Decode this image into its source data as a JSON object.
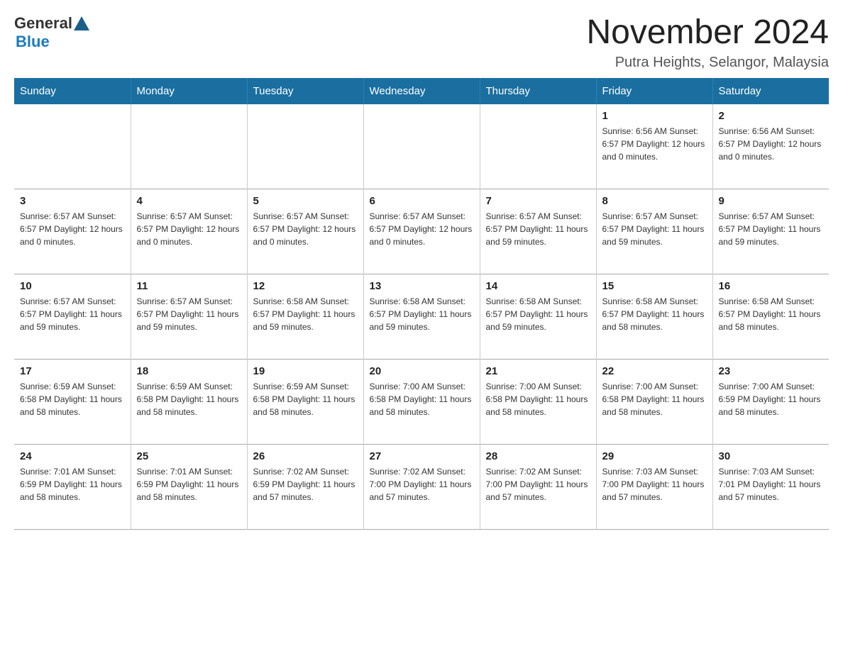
{
  "header": {
    "logo": {
      "general": "General",
      "blue": "Blue"
    },
    "title": "November 2024",
    "location": "Putra Heights, Selangor, Malaysia"
  },
  "columns": [
    "Sunday",
    "Monday",
    "Tuesday",
    "Wednesday",
    "Thursday",
    "Friday",
    "Saturday"
  ],
  "weeks": [
    [
      {
        "day": "",
        "info": ""
      },
      {
        "day": "",
        "info": ""
      },
      {
        "day": "",
        "info": ""
      },
      {
        "day": "",
        "info": ""
      },
      {
        "day": "",
        "info": ""
      },
      {
        "day": "1",
        "info": "Sunrise: 6:56 AM\nSunset: 6:57 PM\nDaylight: 12 hours\nand 0 minutes."
      },
      {
        "day": "2",
        "info": "Sunrise: 6:56 AM\nSunset: 6:57 PM\nDaylight: 12 hours\nand 0 minutes."
      }
    ],
    [
      {
        "day": "3",
        "info": "Sunrise: 6:57 AM\nSunset: 6:57 PM\nDaylight: 12 hours\nand 0 minutes."
      },
      {
        "day": "4",
        "info": "Sunrise: 6:57 AM\nSunset: 6:57 PM\nDaylight: 12 hours\nand 0 minutes."
      },
      {
        "day": "5",
        "info": "Sunrise: 6:57 AM\nSunset: 6:57 PM\nDaylight: 12 hours\nand 0 minutes."
      },
      {
        "day": "6",
        "info": "Sunrise: 6:57 AM\nSunset: 6:57 PM\nDaylight: 12 hours\nand 0 minutes."
      },
      {
        "day": "7",
        "info": "Sunrise: 6:57 AM\nSunset: 6:57 PM\nDaylight: 11 hours\nand 59 minutes."
      },
      {
        "day": "8",
        "info": "Sunrise: 6:57 AM\nSunset: 6:57 PM\nDaylight: 11 hours\nand 59 minutes."
      },
      {
        "day": "9",
        "info": "Sunrise: 6:57 AM\nSunset: 6:57 PM\nDaylight: 11 hours\nand 59 minutes."
      }
    ],
    [
      {
        "day": "10",
        "info": "Sunrise: 6:57 AM\nSunset: 6:57 PM\nDaylight: 11 hours\nand 59 minutes."
      },
      {
        "day": "11",
        "info": "Sunrise: 6:57 AM\nSunset: 6:57 PM\nDaylight: 11 hours\nand 59 minutes."
      },
      {
        "day": "12",
        "info": "Sunrise: 6:58 AM\nSunset: 6:57 PM\nDaylight: 11 hours\nand 59 minutes."
      },
      {
        "day": "13",
        "info": "Sunrise: 6:58 AM\nSunset: 6:57 PM\nDaylight: 11 hours\nand 59 minutes."
      },
      {
        "day": "14",
        "info": "Sunrise: 6:58 AM\nSunset: 6:57 PM\nDaylight: 11 hours\nand 59 minutes."
      },
      {
        "day": "15",
        "info": "Sunrise: 6:58 AM\nSunset: 6:57 PM\nDaylight: 11 hours\nand 58 minutes."
      },
      {
        "day": "16",
        "info": "Sunrise: 6:58 AM\nSunset: 6:57 PM\nDaylight: 11 hours\nand 58 minutes."
      }
    ],
    [
      {
        "day": "17",
        "info": "Sunrise: 6:59 AM\nSunset: 6:58 PM\nDaylight: 11 hours\nand 58 minutes."
      },
      {
        "day": "18",
        "info": "Sunrise: 6:59 AM\nSunset: 6:58 PM\nDaylight: 11 hours\nand 58 minutes."
      },
      {
        "day": "19",
        "info": "Sunrise: 6:59 AM\nSunset: 6:58 PM\nDaylight: 11 hours\nand 58 minutes."
      },
      {
        "day": "20",
        "info": "Sunrise: 7:00 AM\nSunset: 6:58 PM\nDaylight: 11 hours\nand 58 minutes."
      },
      {
        "day": "21",
        "info": "Sunrise: 7:00 AM\nSunset: 6:58 PM\nDaylight: 11 hours\nand 58 minutes."
      },
      {
        "day": "22",
        "info": "Sunrise: 7:00 AM\nSunset: 6:58 PM\nDaylight: 11 hours\nand 58 minutes."
      },
      {
        "day": "23",
        "info": "Sunrise: 7:00 AM\nSunset: 6:59 PM\nDaylight: 11 hours\nand 58 minutes."
      }
    ],
    [
      {
        "day": "24",
        "info": "Sunrise: 7:01 AM\nSunset: 6:59 PM\nDaylight: 11 hours\nand 58 minutes."
      },
      {
        "day": "25",
        "info": "Sunrise: 7:01 AM\nSunset: 6:59 PM\nDaylight: 11 hours\nand 58 minutes."
      },
      {
        "day": "26",
        "info": "Sunrise: 7:02 AM\nSunset: 6:59 PM\nDaylight: 11 hours\nand 57 minutes."
      },
      {
        "day": "27",
        "info": "Sunrise: 7:02 AM\nSunset: 7:00 PM\nDaylight: 11 hours\nand 57 minutes."
      },
      {
        "day": "28",
        "info": "Sunrise: 7:02 AM\nSunset: 7:00 PM\nDaylight: 11 hours\nand 57 minutes."
      },
      {
        "day": "29",
        "info": "Sunrise: 7:03 AM\nSunset: 7:00 PM\nDaylight: 11 hours\nand 57 minutes."
      },
      {
        "day": "30",
        "info": "Sunrise: 7:03 AM\nSunset: 7:01 PM\nDaylight: 11 hours\nand 57 minutes."
      }
    ]
  ]
}
